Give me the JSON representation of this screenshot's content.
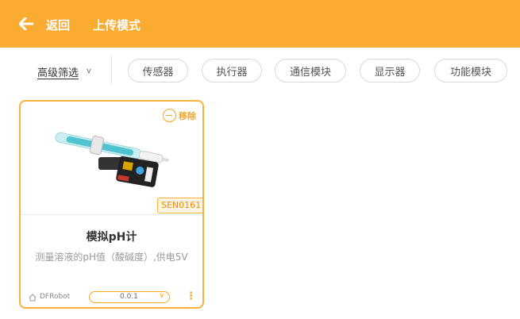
{
  "header": {
    "back_label": "返回",
    "title": "上传模式",
    "background_color": "#f9ab32"
  },
  "filters": {
    "advanced_label": "高级筛选",
    "advanced_caret": "v",
    "categories": [
      "传感器",
      "执行器",
      "通信模块",
      "显示器",
      "功能模块"
    ]
  },
  "cards": [
    {
      "remove_label": "移除",
      "sku": "SEN0161",
      "name": "模拟pH计",
      "description": "测量溶液的pH值（酸碱度）,供电5V",
      "vendor": "DFRobot",
      "version": "0.0.1"
    }
  ],
  "icons": {
    "back": "arrow-left-icon",
    "remove": "minus-circle-icon",
    "vendor": "home-icon",
    "more": "vertical-dots-icon"
  },
  "colors": {
    "accent": "#f9ab32",
    "card_border": "#f9b338",
    "sku_text": "#f08a00"
  }
}
